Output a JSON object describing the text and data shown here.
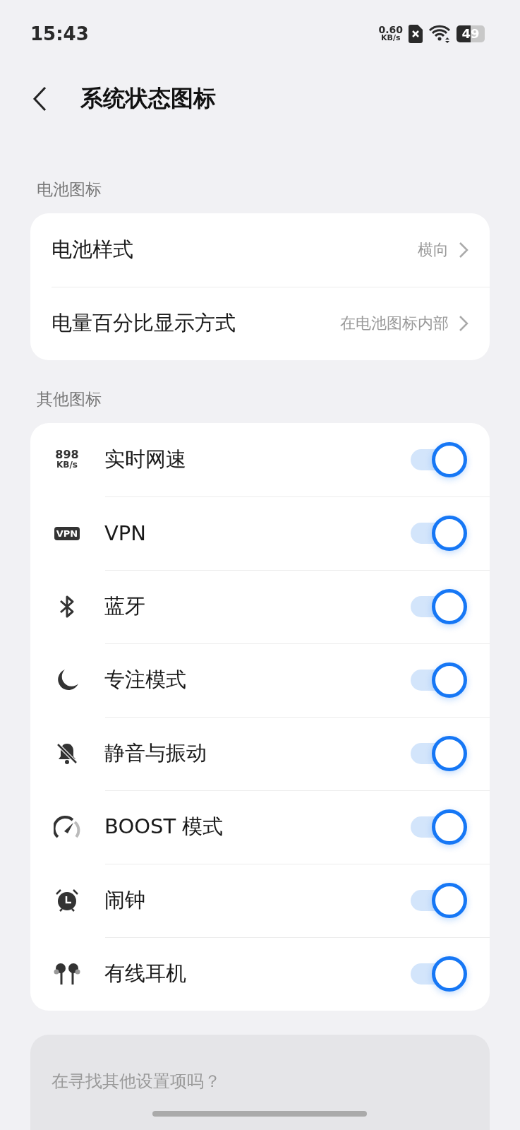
{
  "status_bar": {
    "time": "15:43",
    "net_speed": [
      "0.60",
      "KB/s"
    ],
    "battery": "49"
  },
  "header": {
    "title": "系统状态图标"
  },
  "sections": [
    {
      "title": "电池图标",
      "kind": "nav",
      "items": [
        {
          "label": "电池样式",
          "value": "横向"
        },
        {
          "label": "电量百分比显示方式",
          "value": "在电池图标内部"
        }
      ]
    },
    {
      "title": "其他图标",
      "kind": "toggle",
      "items": [
        {
          "kind": "netspeed",
          "icon_text": [
            "898",
            "KB/s"
          ],
          "label": "实时网速",
          "on": true
        },
        {
          "kind": "vpn",
          "icon_text": [
            "VPN"
          ],
          "label": "VPN",
          "on": true
        },
        {
          "kind": "bluetooth",
          "label": "蓝牙",
          "on": true
        },
        {
          "kind": "moon",
          "label": "专注模式",
          "on": true
        },
        {
          "kind": "belloff",
          "label": "静音与振动",
          "on": true
        },
        {
          "kind": "gauge",
          "label": "BOOST 模式",
          "on": true
        },
        {
          "kind": "alarm",
          "label": "闹钟",
          "on": true
        },
        {
          "kind": "earbuds",
          "label": "有线耳机",
          "on": true
        }
      ]
    }
  ],
  "footer_card": {
    "text": "在寻找其他设置项吗？"
  }
}
